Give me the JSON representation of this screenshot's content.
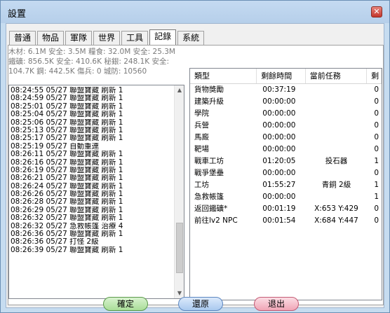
{
  "window": {
    "title": "設置",
    "close_label": "✕"
  },
  "tabs": [
    "普通",
    "物品",
    "軍隊",
    "世界",
    "工具",
    "記錄",
    "系統"
  ],
  "active_tab": "記錄",
  "resources": {
    "line1": [
      "木材: 6.1M",
      "安全: 3.5M",
      "糧食: 32.0M",
      "安全: 25.3M"
    ],
    "line2": [
      "鐵礦: 856.5K",
      "安全: 410.6K",
      "秘銀: 248.1K",
      "安全:"
    ],
    "line3": [
      "104.7K",
      "鋼: 442.5K",
      "傷兵: 0",
      "城防: 10560"
    ]
  },
  "log_lines": [
    "08:24:55 05/27 聯盟寶藏  刷新  1",
    "08:24:59 05/27 聯盟寶藏  刷新  1",
    "08:25:01 05/27 聯盟寶藏  刷新  1",
    "08:25:04 05/27 聯盟寶藏  刷新  1",
    "08:25:06 05/27 聯盟寶藏  刷新  1",
    "08:25:13 05/27 聯盟寶藏  刷新  1",
    "08:25:17 05/27 聯盟寶藏  刷新  1",
    "08:25:19 05/27 自動重連",
    "08:26:11 05/27 聯盟寶藏  刷新  1",
    "08:26:16 05/27 聯盟寶藏  刷新  1",
    "08:26:19 05/27 聯盟寶藏  刷新  1",
    "08:26:21 05/27 聯盟寶藏  刷新  1",
    "08:26:24 05/27 聯盟寶藏  刷新  1",
    "08:26:26 05/27 聯盟寶藏  刷新  1",
    "08:26:28 05/27 聯盟寶藏  刷新  1",
    "08:26:29 05/27 聯盟寶藏  刷新  1",
    "08:26:32 05/27 聯盟寶藏  刷新  1",
    "08:26:32 05/27 急救帳篷  治療  4",
    "08:26:36 05/27 聯盟寶藏  刷新  1",
    "08:26:36 05/27 打怪  2級",
    "08:26:39 05/27 聯盟寶藏  刷新  1"
  ],
  "task_table": {
    "headers": [
      "類型",
      "剩餘時間",
      "當前任務",
      "剩"
    ],
    "rows": [
      [
        "貨物獎勵",
        "00:37:19",
        "",
        "0"
      ],
      [
        "建築升級",
        "00:00:00",
        "",
        "0"
      ],
      [
        "學院",
        "00:00:00",
        "",
        "0"
      ],
      [
        "兵營",
        "00:00:00",
        "",
        "0"
      ],
      [
        "馬廄",
        "00:00:00",
        "",
        "0"
      ],
      [
        "靶場",
        "00:00:00",
        "",
        "0"
      ],
      [
        "戰車工坊",
        "01:20:05",
        "投石器",
        "1"
      ],
      [
        "戰爭堡壘",
        "00:00:00",
        "",
        "0"
      ],
      [
        "工坊",
        "01:55:27",
        "青銅 2級",
        "1"
      ],
      [
        "急救帳篷",
        "00:00:00",
        "",
        "1"
      ],
      [
        "返回鐵礦*",
        "00:01:19",
        "X:653 Y:429",
        "0"
      ],
      [
        "前往lv2 NPC",
        "00:01:54",
        "X:684 Y:447",
        "0"
      ]
    ]
  },
  "buttons": {
    "ok": "確定",
    "restore": "還原",
    "exit": "退出"
  }
}
